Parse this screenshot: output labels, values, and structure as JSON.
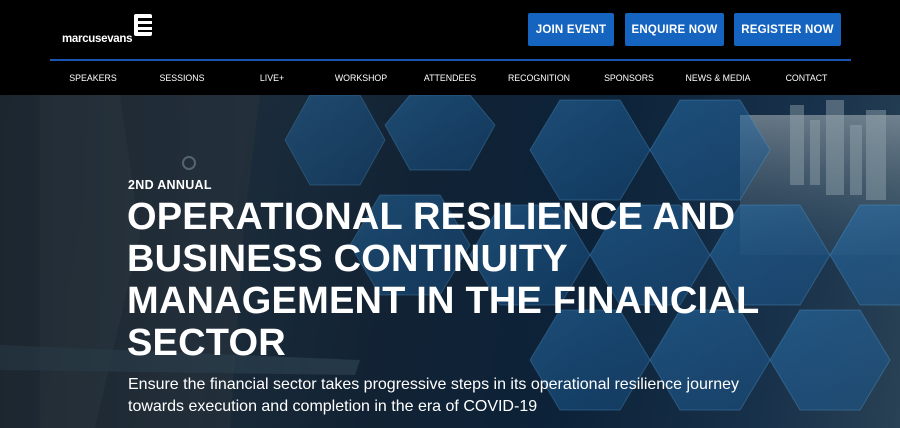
{
  "brand": {
    "name": "marcusevans",
    "logo_icon": "marcus-evans-e-logo"
  },
  "header": {
    "buttons": {
      "join": "JOIN EVENT",
      "enquire": "ENQUIRE NOW",
      "register": "REGISTER NOW"
    },
    "accent_color": "#1565c0"
  },
  "nav": {
    "items": [
      {
        "label": "SPEAKERS"
      },
      {
        "label": "SESSIONS"
      },
      {
        "label": "LIVE+"
      },
      {
        "label": "WORKSHOP"
      },
      {
        "label": "ATTENDEES"
      },
      {
        "label": "RECOGNITION"
      },
      {
        "label": "SPONSORS"
      },
      {
        "label": "NEWS & MEDIA"
      },
      {
        "label": "CONTACT"
      }
    ]
  },
  "hero": {
    "kicker": "2ND ANNUAL",
    "title": "OPERATIONAL RESILIENCE AND BUSINESS CONTINUITY MANAGEMENT IN THE FINANCIAL SECTOR",
    "subtitle": "Ensure the financial sector takes progressive steps in its operational resilience journey towards execution and completion in the era of COVID-19"
  }
}
